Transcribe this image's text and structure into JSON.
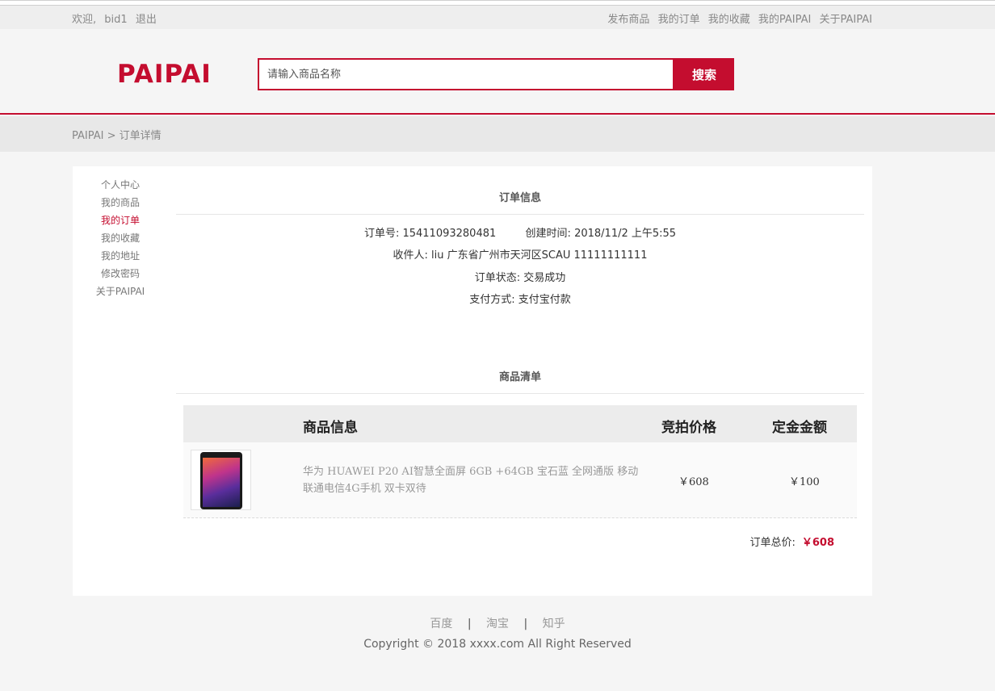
{
  "topbar": {
    "welcome": "欢迎,",
    "username": "bid1",
    "logout": "退出",
    "links": [
      "发布商品",
      "我的订单",
      "我的收藏",
      "我的PAIPAI",
      "关于PAIPAI"
    ]
  },
  "header": {
    "logo": "PAIPAI",
    "search_placeholder": "请输入商品名称",
    "search_button": "搜索"
  },
  "breadcrumb": "PAIPAI > 订单详情",
  "sidenav": {
    "items": [
      "个人中心",
      "我的商品",
      "我的订单",
      "我的收藏",
      "我的地址",
      "修改密码",
      "关于PAIPAI"
    ],
    "active_index": 2
  },
  "order_info": {
    "section_title": "订单信息",
    "order_no_label": "订单号:",
    "order_no": "15411093280481",
    "created_label": "创建时间:",
    "created": "2018/11/2 上午5:55",
    "receiver_label": "收件人:",
    "receiver": "liu 广东省广州市天河区SCAU 11111111111",
    "status_label": "订单状态:",
    "status": "交易成功",
    "payment_label": "支付方式:",
    "payment": "支付宝付款"
  },
  "goods": {
    "section_title": "商品清单",
    "columns": [
      "商品信息",
      "竞拍价格",
      "定金金额"
    ],
    "rows": [
      {
        "name": "华为 HUAWEI P20 AI智慧全面屏 6GB +64GB 宝石蓝 全网通版 移动联通电信4G手机 双卡双待",
        "price": "￥608",
        "deposit": "￥100",
        "image_icon": "phone-product-image"
      }
    ]
  },
  "total": {
    "label": "订单总价:",
    "value": "￥608"
  },
  "footer": {
    "links": [
      "百度",
      "淘宝",
      "知乎"
    ],
    "separator": "|",
    "copyright": "Copyright © 2018 xxxx.com All Right Reserved"
  },
  "colors": {
    "brand": "#c40d2f"
  }
}
